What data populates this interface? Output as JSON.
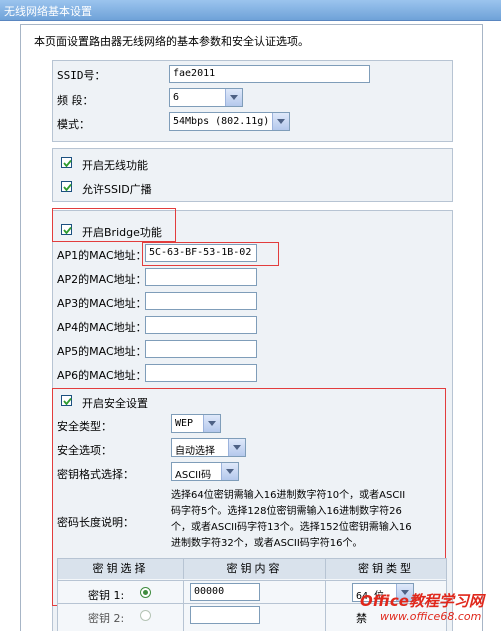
{
  "window": {
    "title": "无线网络基本设置"
  },
  "intro": "本页面设置路由器无线网络的基本参数和安全认证选项。",
  "basic": {
    "ssid_label": "SSID号：",
    "ssid_value": "fae2011",
    "channel_label": "频 段：",
    "channel_value": "6",
    "mode_label": "模式：",
    "mode_value": "54Mbps (802.11g)"
  },
  "options": {
    "enable_wireless": "开启无线功能",
    "enable_ssid_broadcast": "允许SSID广播"
  },
  "bridge": {
    "enable_label": "开启Bridge功能",
    "ap_labels": [
      "AP1的MAC地址：",
      "AP2的MAC地址：",
      "AP3的MAC地址：",
      "AP4的MAC地址：",
      "AP5的MAC地址：",
      "AP6的MAC地址："
    ],
    "ap_values": [
      "5C-63-BF-53-1B-02",
      "",
      "",
      "",
      "",
      ""
    ]
  },
  "security": {
    "enable_label": "开启安全设置",
    "type_label": "安全类型：",
    "type_value": "WEP",
    "option_label": "安全选项：",
    "option_value": "自动选择",
    "format_label": "密钥格式选择：",
    "format_value": "ASCII码",
    "length_label": "密码长度说明：",
    "length_lines": [
      "选择64位密钥需输入16进制数字符10个，或者ASCII",
      "码字符5个。选择128位密钥需输入16进制数字符26",
      "个，或者ASCII码字符13个。选择152位密钥需输入16",
      "进制数字符32个，或者ASCII码字符16个。"
    ],
    "table_headers": [
      "密钥选择",
      "密钥内容",
      "密钥类型"
    ],
    "keys": [
      {
        "label": "密钥 1:",
        "value": "00000",
        "type": "64 位"
      },
      {
        "label": "密钥 2:",
        "value": "",
        "type": "禁"
      }
    ]
  },
  "watermark": {
    "line1": "Office教程学习网",
    "line2": "www.office68.com"
  },
  "colors": {
    "highlight_red": "#e23d3d",
    "title_blue": "#6fa2d8"
  }
}
